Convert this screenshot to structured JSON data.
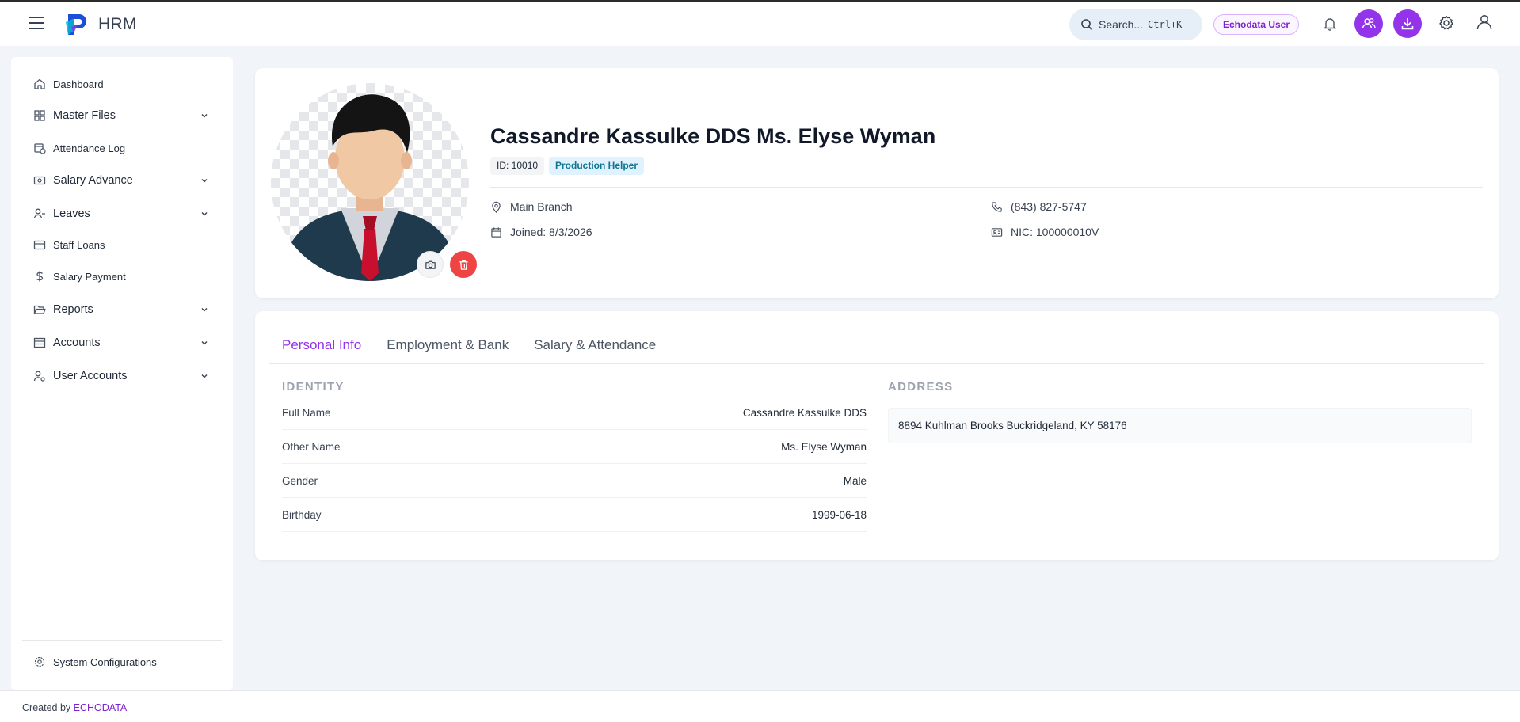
{
  "header": {
    "brand": "HRM",
    "search_label": "Search...",
    "search_shortcut": "Ctrl+K",
    "user_badge": "Echodata User"
  },
  "sidebar": {
    "items": [
      {
        "label": "Dashboard",
        "icon": "home-icon"
      },
      {
        "label": "Master Files",
        "icon": "grid-icon"
      },
      {
        "label": "Attendance Log",
        "icon": "calendar-clock-icon"
      },
      {
        "label": "Salary Advance",
        "icon": "banknote-icon"
      },
      {
        "label": "Leaves",
        "icon": "user-minus-icon"
      },
      {
        "label": "Staff Loans",
        "icon": "wallet-icon"
      },
      {
        "label": "Salary Payment",
        "icon": "dollar-icon"
      },
      {
        "label": "Reports",
        "icon": "folder-open-icon"
      },
      {
        "label": "Accounts",
        "icon": "list-icon"
      },
      {
        "label": "User Accounts",
        "icon": "user-cog-icon"
      }
    ],
    "system": "System Configurations"
  },
  "profile": {
    "name": "Cassandre Kassulke DDS Ms. Elyse Wyman",
    "id_chip": "ID: 10010",
    "role_chip": "Production Helper",
    "branch": "Main Branch",
    "joined": "Joined: 8/3/2026",
    "phone": "(843) 827-5747",
    "nic": "NIC: 100000010V"
  },
  "tabs": [
    "Personal Info",
    "Employment & Bank",
    "Salary & Attendance"
  ],
  "identity": {
    "title": "IDENTITY",
    "rows": [
      {
        "key": "Full Name",
        "value": "Cassandre Kassulke DDS"
      },
      {
        "key": "Other Name",
        "value": "Ms. Elyse Wyman"
      },
      {
        "key": "Gender",
        "value": "Male"
      },
      {
        "key": "Birthday",
        "value": "1999-06-18"
      }
    ]
  },
  "address": {
    "title": "ADDRESS",
    "value": "8894 Kuhlman Brooks Buckridgeland, KY 58176"
  },
  "footer": {
    "created_by": "Created by",
    "company": "ECHODATA"
  },
  "colors": {
    "accent": "#9333ea",
    "danger": "#ef4444",
    "background": "#f1f4f8"
  }
}
